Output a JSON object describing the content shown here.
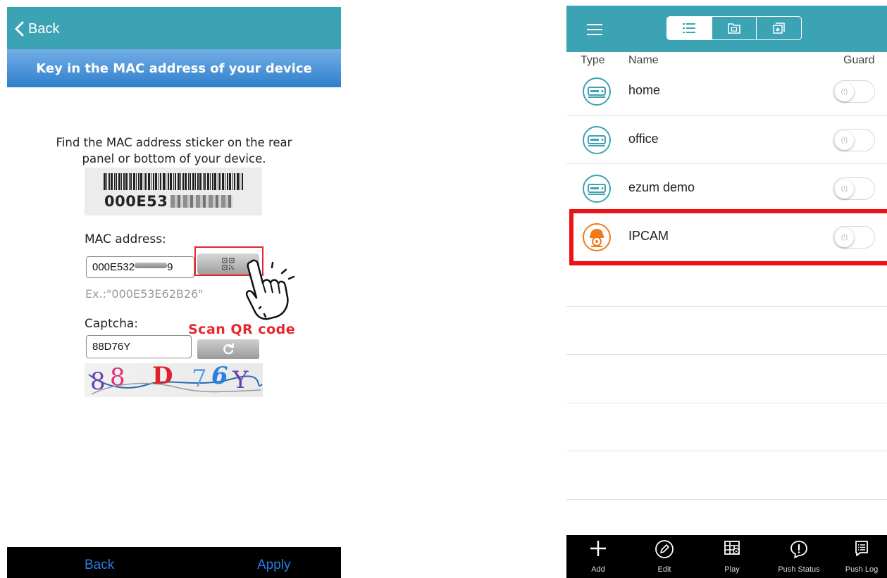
{
  "left": {
    "nav": {
      "back_label": "Back"
    },
    "title": "Key in the MAC address of your device",
    "instructions_line1": "Find the MAC address sticker on the rear",
    "instructions_line2": "panel or bottom of your device.",
    "barcode_text": "000E53",
    "mac": {
      "label": "MAC address:",
      "value_prefix": "000E532",
      "value_suffix": "9",
      "example": "Ex.:\"000E53E62B26\""
    },
    "scan_annotation": "Scan QR code",
    "captcha": {
      "label": "Captcha:",
      "value": "88D76Y",
      "image_chars": [
        {
          "ch": "8",
          "color": "#6a3fb0"
        },
        {
          "ch": "8",
          "color": "#e0307a"
        },
        {
          "ch": "D",
          "color": "#e0202a"
        },
        {
          "ch": "7",
          "color": "#5aa0e8"
        },
        {
          "ch": "6",
          "color": "#2a80e0"
        },
        {
          "ch": "Y",
          "color": "#6a3fb0"
        }
      ]
    },
    "bottom": {
      "back_label": "Back",
      "apply_label": "Apply"
    },
    "colors": {
      "topbar": "#3ba3b3",
      "title_bar": "#2f7fcc",
      "link": "#2a7ee5",
      "annotation": "#e8262b"
    }
  },
  "right": {
    "tabs": [
      "list-icon",
      "folder-icon",
      "favorite-icon"
    ],
    "columns": {
      "type": "Type",
      "name": "Name",
      "guard": "Guard"
    },
    "devices": [
      {
        "name": "home",
        "icon": "dvr-icon",
        "guard": false
      },
      {
        "name": "office",
        "icon": "dvr-icon",
        "guard": false
      },
      {
        "name": "ezum demo",
        "icon": "dvr-icon",
        "guard": false
      },
      {
        "name": "IPCAM",
        "icon": "ipcam-icon",
        "guard": false,
        "highlighted": true
      }
    ],
    "toolbar": [
      {
        "label": "Add",
        "icon": "plus-icon"
      },
      {
        "label": "Edit",
        "icon": "edit-icon"
      },
      {
        "label": "Play",
        "icon": "play-grid-icon"
      },
      {
        "label": "Push Status",
        "icon": "push-status-icon"
      },
      {
        "label": "Push Log",
        "icon": "push-log-icon"
      }
    ],
    "colors": {
      "topbar": "#3ba3b3",
      "dvr_icon": "#3ba3b3",
      "ipcam_icon": "#f07a1a",
      "highlight": "#ee1111"
    }
  }
}
